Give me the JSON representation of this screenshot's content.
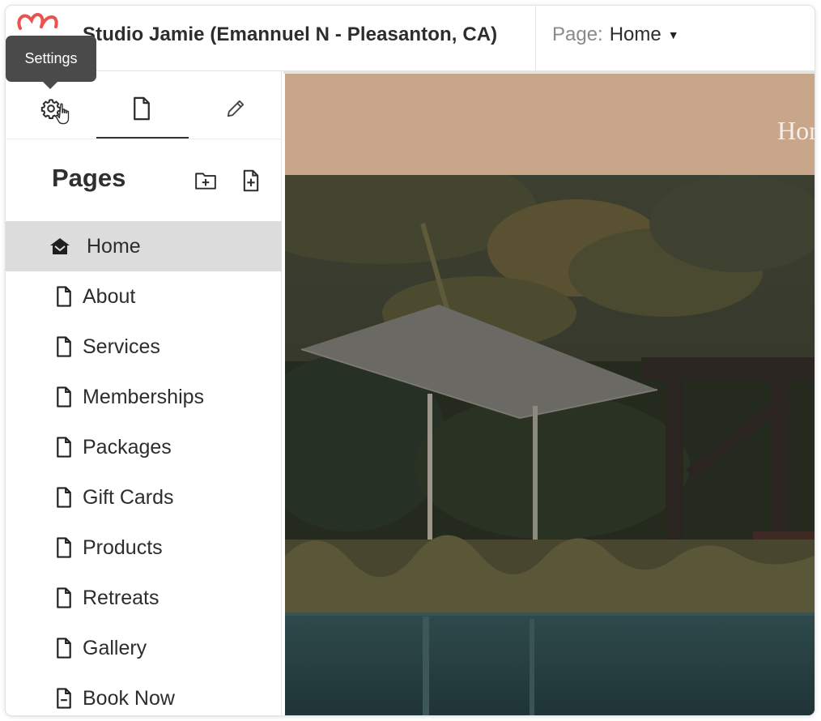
{
  "header": {
    "studio_title": "Studio Jamie (Emannuel N - Pleasanton, CA)",
    "page_prefix": "Page:",
    "page_value": "Home"
  },
  "tooltip": {
    "text": "Settings"
  },
  "sidebar": {
    "tabs": [
      {
        "icon": "gear-icon",
        "active": false
      },
      {
        "icon": "page-icon",
        "active": true
      },
      {
        "icon": "pencil-icon",
        "active": false
      }
    ],
    "pages_title": "Pages",
    "items": [
      {
        "label": "Home",
        "icon": "home-icon",
        "active": true
      },
      {
        "label": "About",
        "icon": "page-icon"
      },
      {
        "label": "Services",
        "icon": "page-icon"
      },
      {
        "label": "Memberships",
        "icon": "page-icon"
      },
      {
        "label": "Packages",
        "icon": "page-icon"
      },
      {
        "label": "Gift Cards",
        "icon": "page-icon"
      },
      {
        "label": "Products",
        "icon": "page-icon"
      },
      {
        "label": "Retreats",
        "icon": "page-icon"
      },
      {
        "label": "Gallery",
        "icon": "page-icon"
      },
      {
        "label": "Book Now",
        "icon": "booking-page-icon"
      }
    ]
  },
  "preview": {
    "nav_text": "Hom"
  },
  "colors": {
    "brand_logo": "#e8524f",
    "active_row": "#dcdcdc",
    "preview_band": "#c7a689",
    "tooltip_bg": "#4a4a4a"
  }
}
